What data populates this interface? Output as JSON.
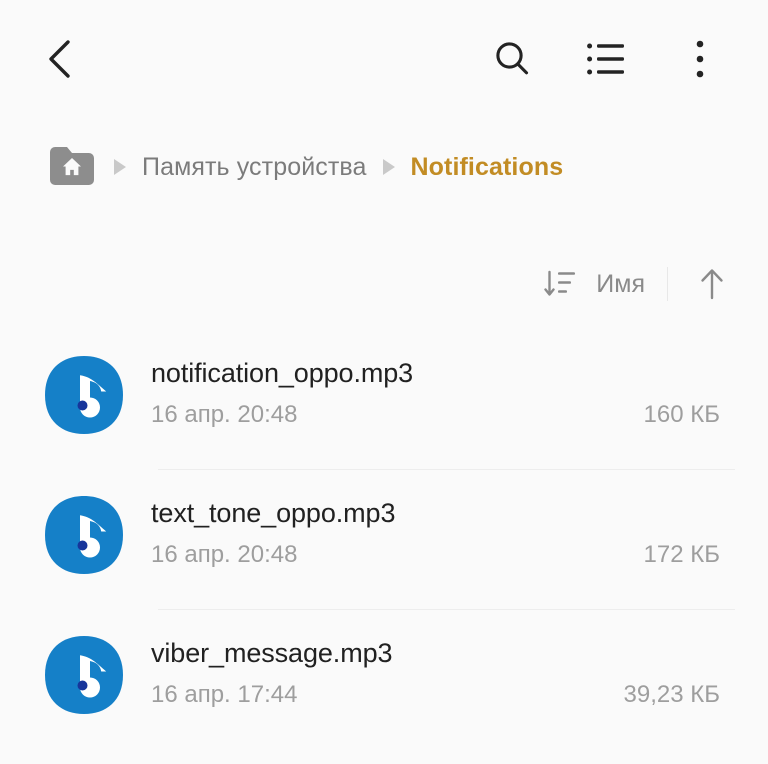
{
  "appbar": {
    "back_icon": "chevron-left-icon",
    "search_icon": "search-icon",
    "view_mode_icon": "list-view-icon",
    "overflow_icon": "more-vertical-icon"
  },
  "breadcrumb": {
    "home_icon": "home-folder-icon",
    "separator_icon": "triangle-right-icon",
    "items": [
      {
        "label": "Память устройства",
        "current": false
      },
      {
        "label": "Notifications",
        "current": true
      }
    ],
    "current_color": "#c28c24",
    "inactive_color": "#7b7b7b"
  },
  "sortbar": {
    "sort_icon": "sort-descending-icon",
    "label": "Имя",
    "direction_icon": "arrow-up-icon"
  },
  "files": [
    {
      "icon": "music-note-icon",
      "name": "notification_oppo.mp3",
      "date": "16 апр. 20:48",
      "size": "160 КБ"
    },
    {
      "icon": "music-note-icon",
      "name": "text_tone_oppo.mp3",
      "date": "16 апр. 20:48",
      "size": "172 КБ"
    },
    {
      "icon": "music-note-icon",
      "name": "viber_message.mp3",
      "date": "16 апр. 17:44",
      "size": "39,23 КБ"
    }
  ],
  "colors": {
    "background": "#fafafa",
    "audio_icon_blue": "#1580c8",
    "audio_note_dot": "#17359b",
    "accent": "#c28c24"
  }
}
